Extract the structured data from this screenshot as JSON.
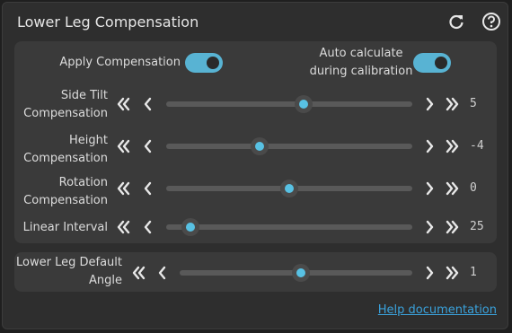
{
  "title": "Lower Leg Compensation",
  "header": {
    "reset_icon": "refresh-icon",
    "help_icon": "help-circle-icon"
  },
  "toggles": {
    "apply": {
      "label": "Apply Compensation",
      "on": true
    },
    "auto": {
      "label_line1": "Auto calculate",
      "label_line2": "during calibration",
      "on": true
    }
  },
  "sliders": [
    {
      "label1": "Side Tilt",
      "label2": "Compensation",
      "value": "5",
      "fraction": 0.56
    },
    {
      "label1": "Height",
      "label2": "Compensation",
      "value": "-4",
      "fraction": 0.38
    },
    {
      "label1": "Rotation",
      "label2": "Compensation",
      "value": "0",
      "fraction": 0.5
    },
    {
      "label1": "Linear Interval",
      "label2": "",
      "value": "25",
      "fraction": 0.1
    }
  ],
  "default_angle": {
    "label1": "Lower Leg Default",
    "label2": "Angle",
    "value": "1",
    "fraction": 0.52
  },
  "help_link": "Help documentation",
  "colors": {
    "accent": "#58c1e3",
    "panel": "#2e2e2e",
    "group": "#3a3a3a",
    "link": "#3aa2dc"
  }
}
